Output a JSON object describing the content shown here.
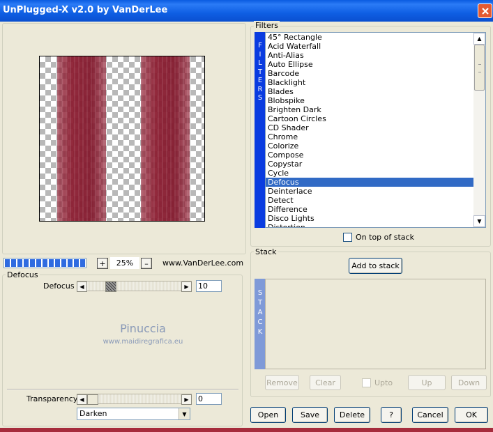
{
  "window": {
    "title": "UnPlugged-X v2.0 by VanDerLee",
    "close_icon": "close-icon"
  },
  "preview": {
    "zoom": "25%",
    "zoom_in": "+",
    "zoom_out": "–",
    "progress": 1.0,
    "website": "www.VanDerLee.com"
  },
  "watermark": {
    "name": "Pinuccia",
    "url": "www.maidiregrafica.eu"
  },
  "filters": {
    "group_label": "Filters",
    "vertical_label": [
      "F",
      "I",
      "L",
      "T",
      "E",
      "R",
      "S"
    ],
    "items": [
      "45° Rectangle",
      "Acid Waterfall",
      "Anti-Alias",
      "Auto Ellipse",
      "Barcode",
      "Blacklight",
      "Blades",
      "Blobspike",
      "Brighten Dark",
      "Cartoon Circles",
      "CD Shader",
      "Chrome",
      "Colorize",
      "Compose",
      "Copystar",
      "Cycle",
      "Defocus",
      "Deinterlace",
      "Detect",
      "Difference",
      "Disco Lights",
      "Distortion"
    ],
    "selected_index": 16,
    "on_top_label": "On top of stack"
  },
  "stack": {
    "group_label": "Stack",
    "vertical_label": [
      "S",
      "T",
      "A",
      "C",
      "K"
    ],
    "add_label": "Add to stack",
    "remove_label": "Remove",
    "clear_label": "Clear",
    "upto_label": "Upto",
    "up_label": "Up",
    "down_label": "Down"
  },
  "params": {
    "group_label": "Defocus",
    "defocus_label": "Defocus",
    "defocus_value": "10",
    "transparency_label": "Transparency",
    "transparency_value": "0",
    "blend_mode": "Darken"
  },
  "footer": {
    "open": "Open",
    "save": "Save",
    "delete": "Delete",
    "help": "?",
    "cancel": "Cancel",
    "ok": "OK"
  },
  "colors": {
    "titlebar": "#0A5BE0",
    "selection": "#316AC5",
    "filters_bar": "#0A3CE0",
    "stack_bar": "#7F9AD8"
  }
}
